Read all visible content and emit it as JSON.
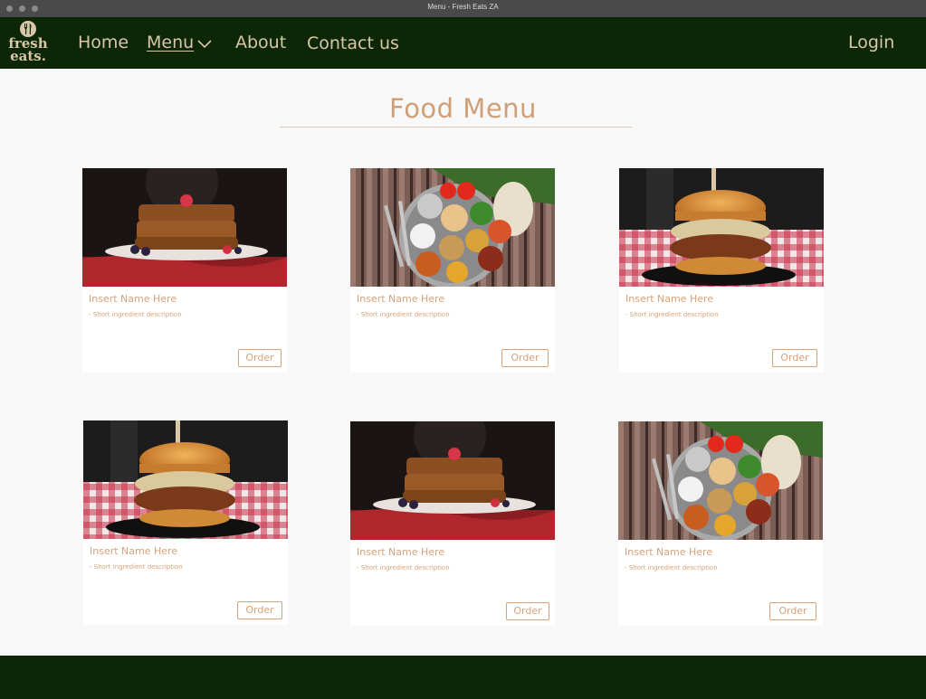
{
  "window": {
    "title": "Menu - Fresh Eats ZA"
  },
  "brand": {
    "logo_line1": "fresh",
    "logo_line2": "eats."
  },
  "nav": {
    "home": "Home",
    "menu": "Menu",
    "about": "About",
    "contact": "Contact us",
    "login": "Login"
  },
  "page": {
    "title": "Food Menu"
  },
  "cards": [
    {
      "image": "french-toast",
      "name": "Insert Name Here",
      "desc": "- Short ingredient description",
      "order": "Order"
    },
    {
      "image": "thali-platter",
      "name": "Insert Name Here",
      "desc": "- Short ingredient description",
      "order": "Order"
    },
    {
      "image": "pulled-pork-burger",
      "name": "Insert Name Here",
      "desc": "- Short ingredient description",
      "order": "Order"
    },
    {
      "image": "pulled-pork-burger",
      "name": "Insert Name Here",
      "desc": "- Short ingredient description",
      "order": "Order"
    },
    {
      "image": "french-toast",
      "name": "Insert Name Here",
      "desc": "- Short ingredient description",
      "order": "Order"
    },
    {
      "image": "thali-platter",
      "name": "Insert Name Here",
      "desc": "- Short ingredient description",
      "order": "Order"
    }
  ],
  "colors": {
    "nav_bg": "#0c2705",
    "nav_text": "#d9c6a9",
    "accent": "#cfa077",
    "page_bg": "#f8f8f8"
  }
}
